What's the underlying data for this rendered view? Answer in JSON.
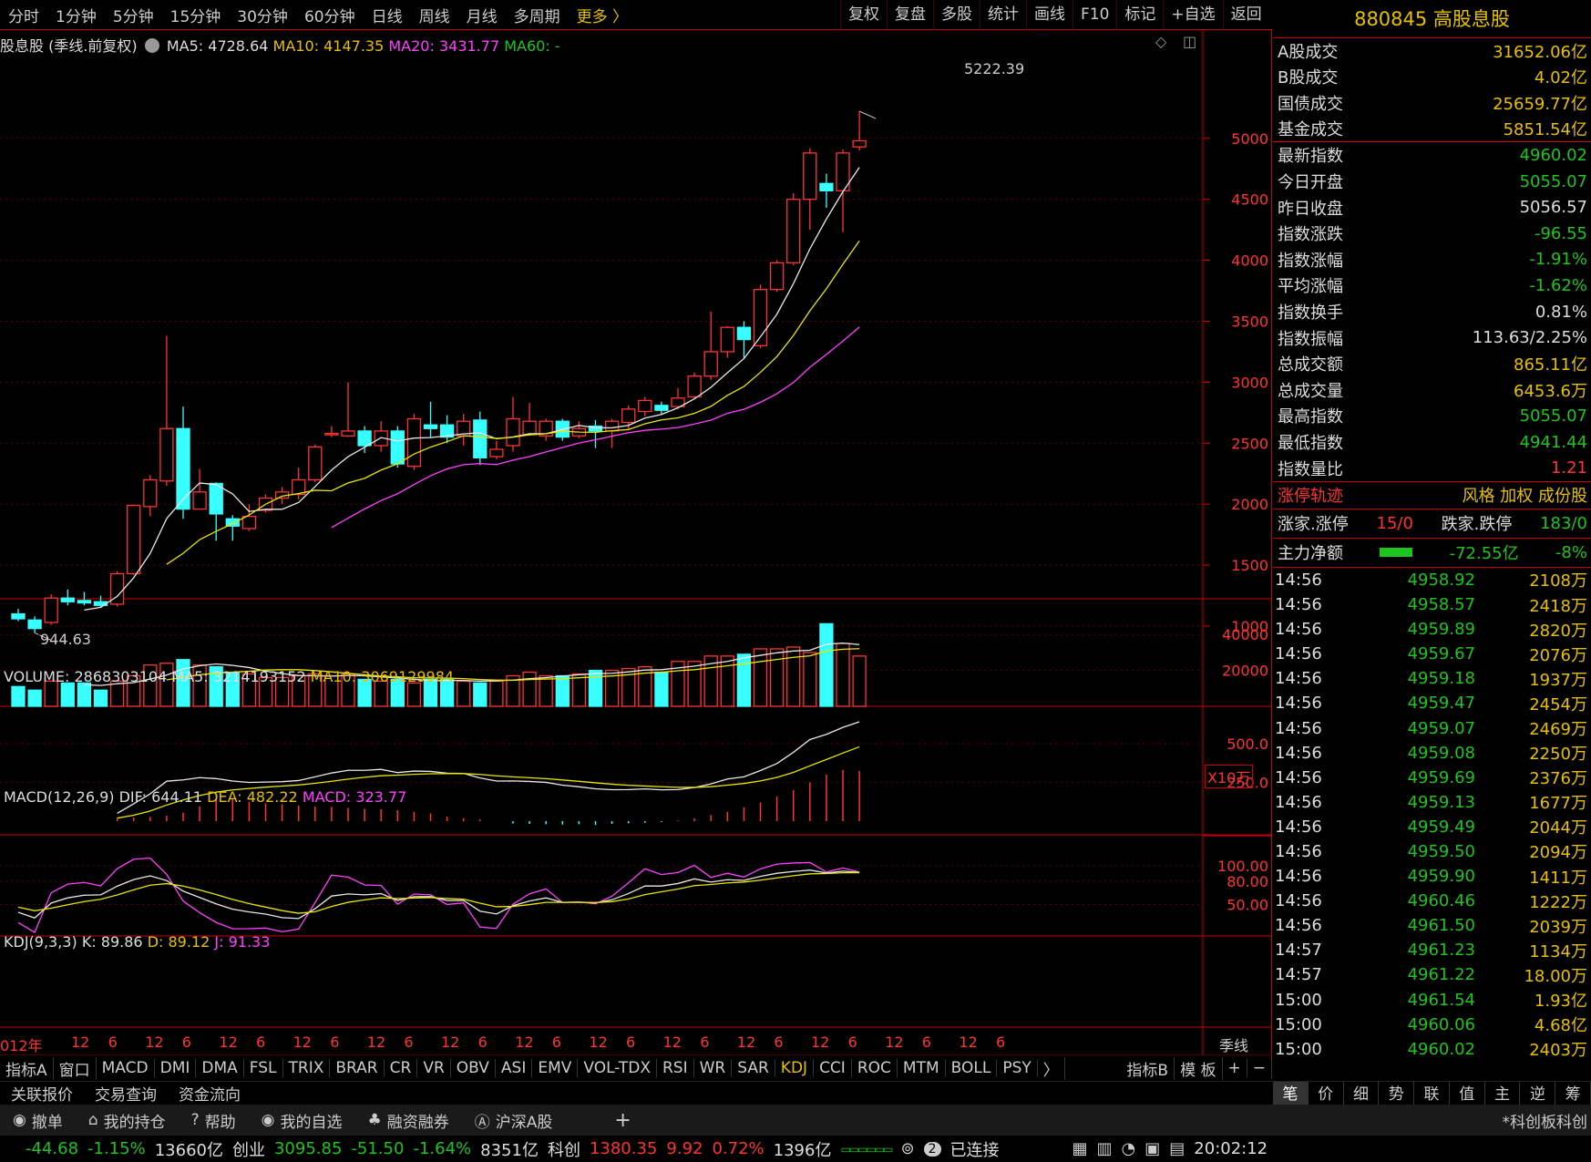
{
  "toolbar": {
    "periods": [
      "分时",
      "1分钟",
      "5分钟",
      "15分钟",
      "30分钟",
      "60分钟",
      "日线",
      "周线",
      "月线",
      "多周期"
    ],
    "more": "更多 〉",
    "right_tools": [
      "复权",
      "复盘",
      "多股",
      "统计",
      "画线",
      "F10",
      "标记",
      "+自选",
      "返回"
    ]
  },
  "legend": {
    "name": "股息股 (季线.前复权)",
    "ma5": "MA5: 4728.64",
    "ma10": "MA10: 4147.35",
    "ma20": "MA20: 3431.77",
    "ma60": "MA60: -",
    "high_label": "5222.39",
    "low_label": "944.63",
    "volume": "VOLUME: 2868303104",
    "vol_ma5": "MA5: 3214193152",
    "vol_ma10": "MA10: 3069129984",
    "vol_unit": "X10万",
    "macd_name": "MACD(12,26,9)",
    "dif": "DIF: 644.11",
    "dea": "DEA: 482.22",
    "macd": "MACD: 323.77",
    "kdj_name": "KDJ(9,3,3)",
    "k": "K: 89.86",
    "d": "D: 89.12",
    "j": "J: 91.33",
    "year_label": "012年",
    "period_label": "季线"
  },
  "chart_data": {
    "type": "candlestick",
    "price_ticks": [
      5000,
      4500,
      4000,
      3500,
      3000,
      2500,
      2000,
      1500,
      1000
    ],
    "volume_ticks": [
      "40000",
      "20000"
    ],
    "macd_ticks": [
      "500.0",
      "250.0"
    ],
    "kdj_ticks": [
      "100.00",
      "80.00",
      "50.00"
    ],
    "x_ticks": [
      "12",
      "6",
      "12",
      "6",
      "12",
      "6",
      "12",
      "6",
      "12",
      "6",
      "12",
      "6",
      "12",
      "6",
      "12",
      "6",
      "12",
      "6",
      "12",
      "6",
      "12",
      "6",
      "12",
      "6",
      "12",
      "6"
    ],
    "candles": [
      {
        "o": 1100,
        "c": 1060,
        "h": 1140,
        "l": 1040
      },
      {
        "o": 1050,
        "c": 980,
        "h": 1080,
        "l": 944.63
      },
      {
        "o": 1030,
        "c": 1230,
        "h": 1260,
        "l": 1010
      },
      {
        "o": 1230,
        "c": 1200,
        "h": 1300,
        "l": 1170
      },
      {
        "o": 1210,
        "c": 1190,
        "h": 1280,
        "l": 1170
      },
      {
        "o": 1200,
        "c": 1170,
        "h": 1250,
        "l": 1150
      },
      {
        "o": 1180,
        "c": 1430,
        "h": 1450,
        "l": 1160
      },
      {
        "o": 1430,
        "c": 1990,
        "h": 2000,
        "l": 1420
      },
      {
        "o": 1980,
        "c": 2200,
        "h": 2240,
        "l": 1900
      },
      {
        "o": 2190,
        "c": 2620,
        "h": 3380,
        "l": 2150
      },
      {
        "o": 2620,
        "c": 1960,
        "h": 2800,
        "l": 1880
      },
      {
        "o": 1960,
        "c": 2100,
        "h": 2290,
        "l": 1960
      },
      {
        "o": 2170,
        "c": 1920,
        "h": 2180,
        "l": 1700
      },
      {
        "o": 1880,
        "c": 1820,
        "h": 1910,
        "l": 1700
      },
      {
        "o": 1800,
        "c": 1900,
        "h": 2000,
        "l": 1780
      },
      {
        "o": 1950,
        "c": 2050,
        "h": 2080,
        "l": 1930
      },
      {
        "o": 2050,
        "c": 2100,
        "h": 2140,
        "l": 2000
      },
      {
        "o": 2080,
        "c": 2200,
        "h": 2300,
        "l": 2040
      },
      {
        "o": 2200,
        "c": 2470,
        "h": 2490,
        "l": 2180
      },
      {
        "o": 2580,
        "c": 2580,
        "h": 2640,
        "l": 2550
      },
      {
        "o": 2560,
        "c": 2600,
        "h": 3000,
        "l": 2550
      },
      {
        "o": 2600,
        "c": 2480,
        "h": 2640,
        "l": 2420
      },
      {
        "o": 2480,
        "c": 2600,
        "h": 2680,
        "l": 2430
      },
      {
        "o": 2600,
        "c": 2330,
        "h": 2640,
        "l": 2300
      },
      {
        "o": 2310,
        "c": 2700,
        "h": 2740,
        "l": 2280
      },
      {
        "o": 2650,
        "c": 2620,
        "h": 2840,
        "l": 2550
      },
      {
        "o": 2650,
        "c": 2550,
        "h": 2730,
        "l": 2500
      },
      {
        "o": 2560,
        "c": 2680,
        "h": 2740,
        "l": 2480
      },
      {
        "o": 2690,
        "c": 2380,
        "h": 2760,
        "l": 2320
      },
      {
        "o": 2390,
        "c": 2450,
        "h": 2520,
        "l": 2370
      },
      {
        "o": 2480,
        "c": 2700,
        "h": 2880,
        "l": 2430
      },
      {
        "o": 2570,
        "c": 2680,
        "h": 2830,
        "l": 2560
      },
      {
        "o": 2560,
        "c": 2680,
        "h": 2700,
        "l": 2520
      },
      {
        "o": 2680,
        "c": 2550,
        "h": 2700,
        "l": 2520
      },
      {
        "o": 2560,
        "c": 2620,
        "h": 2680,
        "l": 2540
      },
      {
        "o": 2640,
        "c": 2600,
        "h": 2690,
        "l": 2460
      },
      {
        "o": 2600,
        "c": 2680,
        "h": 2700,
        "l": 2460
      },
      {
        "o": 2670,
        "c": 2780,
        "h": 2810,
        "l": 2620
      },
      {
        "o": 2760,
        "c": 2850,
        "h": 2880,
        "l": 2720
      },
      {
        "o": 2810,
        "c": 2770,
        "h": 2840,
        "l": 2740
      },
      {
        "o": 2800,
        "c": 2870,
        "h": 2950,
        "l": 2780
      },
      {
        "o": 2880,
        "c": 3050,
        "h": 3080,
        "l": 2860
      },
      {
        "o": 3050,
        "c": 3250,
        "h": 3580,
        "l": 3020
      },
      {
        "o": 3250,
        "c": 3450,
        "h": 3460,
        "l": 3200
      },
      {
        "o": 3450,
        "c": 3350,
        "h": 3500,
        "l": 3200
      },
      {
        "o": 3300,
        "c": 3760,
        "h": 3800,
        "l": 3280
      },
      {
        "o": 3760,
        "c": 3980,
        "h": 4000,
        "l": 3740
      },
      {
        "o": 3980,
        "c": 4500,
        "h": 4550,
        "l": 3960
      },
      {
        "o": 4500,
        "c": 4880,
        "h": 4920,
        "l": 4250
      },
      {
        "o": 4630,
        "c": 4570,
        "h": 4710,
        "l": 4430
      },
      {
        "o": 4570,
        "c": 4880,
        "h": 4910,
        "l": 4230
      },
      {
        "o": 4930,
        "c": 4980,
        "h": 5222.39,
        "l": 4900
      }
    ],
    "volume": [
      11000,
      9000,
      14000,
      13000,
      13000,
      9000,
      14000,
      17000,
      23000,
      24000,
      26000,
      23000,
      22000,
      19000,
      18000,
      16000,
      16000,
      17000,
      18000,
      17000,
      18000,
      15000,
      14000,
      15000,
      13000,
      15000,
      15000,
      14000,
      13000,
      14000,
      17000,
      19000,
      17000,
      17000,
      18000,
      20000,
      20000,
      21000,
      22000,
      19000,
      25000,
      25000,
      28000,
      28000,
      29000,
      32000,
      32000,
      33000,
      30000,
      46000,
      35000,
      28000,
      30000
    ],
    "macd_hist": [
      20,
      24,
      28,
      35,
      55,
      95,
      140,
      145,
      125,
      115,
      110,
      100,
      95,
      92,
      85,
      80,
      78,
      70,
      60,
      50,
      30,
      20,
      10,
      0,
      -15,
      -18,
      -20,
      -22,
      -20,
      -25,
      -18,
      -14,
      -10,
      -5,
      5,
      18,
      40,
      60,
      90,
      120,
      160,
      200,
      250,
      300,
      330,
      324
    ]
  },
  "right_panel": {
    "title": "880845 高股息股",
    "stats1": [
      {
        "label": "A股成交",
        "value": "31652.06亿"
      },
      {
        "label": "B股成交",
        "value": "4.02亿"
      },
      {
        "label": "国债成交",
        "value": "25659.77亿"
      },
      {
        "label": "基金成交",
        "value": "5851.54亿"
      }
    ],
    "stats2": [
      {
        "label": "最新指数",
        "value": "4960.02",
        "color": "g"
      },
      {
        "label": "今日开盘",
        "value": "5055.07",
        "color": "g"
      },
      {
        "label": "昨日收盘",
        "value": "5056.57",
        "color": "w"
      },
      {
        "label": "指数涨跌",
        "value": "-96.55",
        "color": "g"
      },
      {
        "label": "指数涨幅",
        "value": "-1.91%",
        "color": "g"
      },
      {
        "label": "平均涨幅",
        "value": "-1.62%",
        "color": "g"
      },
      {
        "label": "指数换手",
        "value": "0.81%",
        "color": "w"
      },
      {
        "label": "指数振幅",
        "value": "113.63/2.25%",
        "color": "w"
      },
      {
        "label": "总成交额",
        "value": "865.11亿",
        "color": "y"
      },
      {
        "label": "总成交量",
        "value": "6453.6万",
        "color": "y"
      },
      {
        "label": "最高指数",
        "value": "5055.07",
        "color": "g"
      },
      {
        "label": "最低指数",
        "value": "4941.44",
        "color": "g"
      },
      {
        "label": "指数量比",
        "value": "1.21",
        "color": "r"
      }
    ],
    "zt": {
      "label": "涨停轨迹",
      "links": "风格 加权 成份股"
    },
    "updown": {
      "up_label": "涨家.涨停",
      "up_value": "15/0",
      "down_label": "跌家.跌停",
      "down_value": "183/0"
    },
    "flow": {
      "label": "主力净额",
      "value": "-72.55亿",
      "pct": "-8%"
    },
    "ticks": [
      {
        "t": "14:56",
        "p": "4958.92",
        "v": "2108万"
      },
      {
        "t": "14:56",
        "p": "4958.57",
        "v": "2418万"
      },
      {
        "t": "14:56",
        "p": "4959.89",
        "v": "2820万"
      },
      {
        "t": "14:56",
        "p": "4959.67",
        "v": "2076万"
      },
      {
        "t": "14:56",
        "p": "4959.18",
        "v": "1937万"
      },
      {
        "t": "14:56",
        "p": "4959.47",
        "v": "2454万"
      },
      {
        "t": "14:56",
        "p": "4959.07",
        "v": "2469万"
      },
      {
        "t": "14:56",
        "p": "4959.08",
        "v": "2250万"
      },
      {
        "t": "14:56",
        "p": "4959.69",
        "v": "2376万"
      },
      {
        "t": "14:56",
        "p": "4959.13",
        "v": "1677万"
      },
      {
        "t": "14:56",
        "p": "4959.49",
        "v": "2044万"
      },
      {
        "t": "14:56",
        "p": "4959.50",
        "v": "2094万"
      },
      {
        "t": "14:56",
        "p": "4959.90",
        "v": "1411万"
      },
      {
        "t": "14:56",
        "p": "4960.46",
        "v": "1222万"
      },
      {
        "t": "14:56",
        "p": "4961.50",
        "v": "2039万"
      },
      {
        "t": "14:57",
        "p": "4961.23",
        "v": "1134万"
      },
      {
        "t": "14:57",
        "p": "4961.22",
        "v": "18.00万"
      },
      {
        "t": "15:00",
        "p": "4961.54",
        "v": "1.93亿"
      },
      {
        "t": "15:00",
        "p": "4960.06",
        "v": "4.68亿"
      },
      {
        "t": "15:00",
        "p": "4960.02",
        "v": "2403万"
      }
    ],
    "tabs": [
      "笔",
      "价",
      "细",
      "势",
      "联",
      "值",
      "主",
      "逆",
      "筹"
    ]
  },
  "indicator_tabs": [
    "指标A",
    "窗口",
    "MACD",
    "DMI",
    "DMA",
    "FSL",
    "TRIX",
    "BRAR",
    "CR",
    "VR",
    "OBV",
    "ASI",
    "EMV",
    "VOL-TDX",
    "RSI",
    "WR",
    "SAR",
    "KDJ",
    "CCI",
    "ROC",
    "MTM",
    "BOLL",
    "PSY",
    "〉"
  ],
  "indicator_right": [
    "指标B",
    "模 板",
    "+",
    "−"
  ],
  "bar2": [
    "关联报价",
    "交易查询",
    "资金流向"
  ],
  "bar3": [
    "撤单",
    "我的持仓",
    "帮助",
    "我的自选",
    "融资融券",
    "沪深A股",
    "+"
  ],
  "bar3_right": "*科创板科创",
  "status": {
    "seg1a": "-44.68",
    "seg1b": "-1.15%",
    "seg1c": "13660亿",
    "cy_name": "创业",
    "cy_price": "3095.85",
    "cy_chg": "-51.50",
    "cy_pct": "-1.64%",
    "cy_amt": "8351亿",
    "kc_name": "科创",
    "kc_price": "1380.35",
    "kc_chg": "9.92",
    "kc_pct": "0.72%",
    "kc_amt": "1396亿",
    "conn": "已连接",
    "time": "20:02:12",
    "conn_num": "2"
  }
}
